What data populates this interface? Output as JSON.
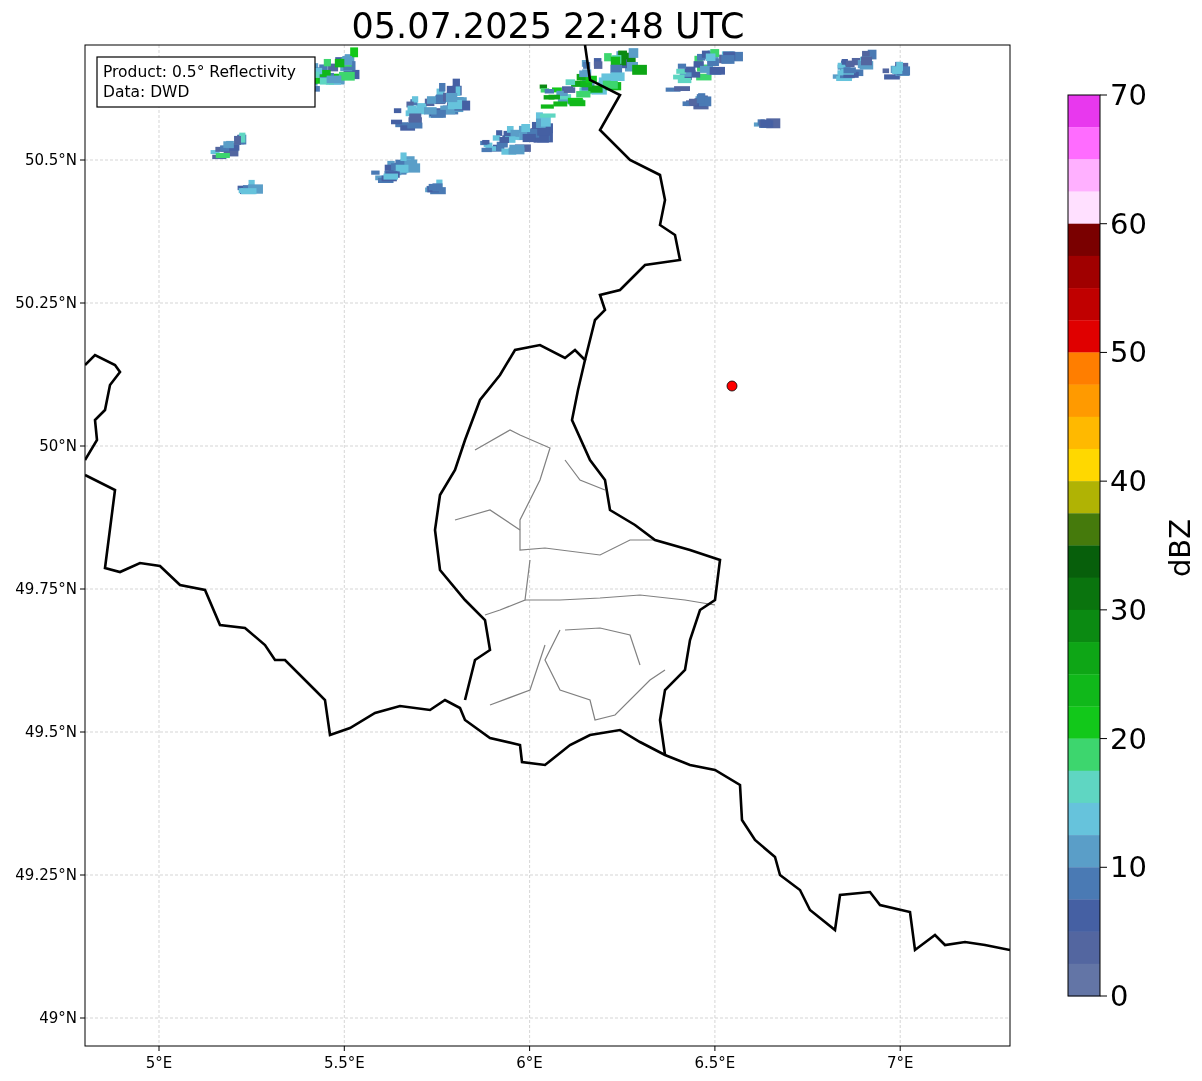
{
  "title": "05.07.2025 22:48 UTC",
  "info_box": [
    "Product: 0.5° Reflectivity",
    "Data: DWD"
  ],
  "map": {
    "x_ticks": [
      "5°E",
      "5.5°E",
      "6°E",
      "6.5°E",
      "7°E"
    ],
    "y_ticks": [
      "50.5°N",
      "50.25°N",
      "50°N",
      "49.75°N",
      "49.5°N",
      "49.25°N",
      "49°N"
    ]
  },
  "colorbar": {
    "label": "dBZ",
    "ticks": [
      "70",
      "60",
      "50",
      "40",
      "30",
      "20",
      "10",
      "0"
    ],
    "bins": [
      {
        "color": "#e838ee"
      },
      {
        "color": "#ff6cff"
      },
      {
        "color": "#ffb0ff"
      },
      {
        "color": "#ffe0ff"
      },
      {
        "color": "#7a0000"
      },
      {
        "color": "#a00000"
      },
      {
        "color": "#c00000"
      },
      {
        "color": "#e00000"
      },
      {
        "color": "#ff7e00"
      },
      {
        "color": "#ff9a00"
      },
      {
        "color": "#ffb900"
      },
      {
        "color": "#ffd800"
      },
      {
        "color": "#b0b304"
      },
      {
        "color": "#457a0c"
      },
      {
        "color": "#075f0b"
      },
      {
        "color": "#0a740e"
      },
      {
        "color": "#0b8a12"
      },
      {
        "color": "#0ea616"
      },
      {
        "color": "#10b81a"
      },
      {
        "color": "#12c81a"
      },
      {
        "color": "#3dd66e"
      },
      {
        "color": "#5fd6c2"
      },
      {
        "color": "#66c3dc"
      },
      {
        "color": "#5a9ec8"
      },
      {
        "color": "#4a7ab4"
      },
      {
        "color": "#4560a3"
      },
      {
        "color": "#5366a0"
      },
      {
        "color": "#6375a6"
      }
    ]
  }
}
